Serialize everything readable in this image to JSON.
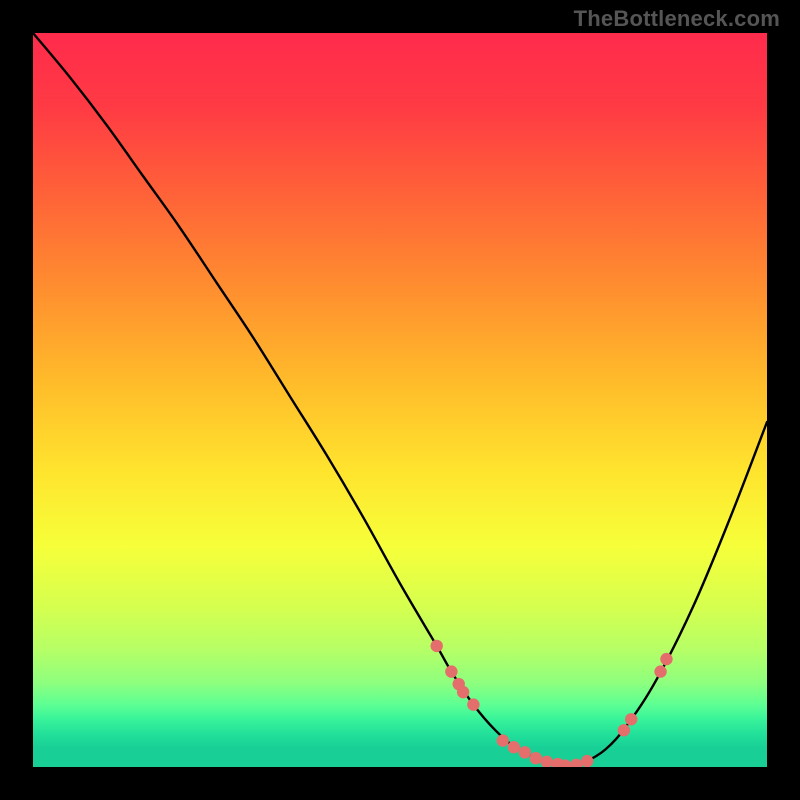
{
  "watermark": "TheBottleneck.com",
  "colors": {
    "background": "#000000",
    "curve": "#000000",
    "dot_fill": "#e46e6b",
    "gradient_stops": [
      {
        "offset": 0.0,
        "color": "#ff2b4c"
      },
      {
        "offset": 0.1,
        "color": "#ff3a44"
      },
      {
        "offset": 0.22,
        "color": "#ff6238"
      },
      {
        "offset": 0.35,
        "color": "#ff8f2f"
      },
      {
        "offset": 0.48,
        "color": "#ffbd2a"
      },
      {
        "offset": 0.6,
        "color": "#ffe52e"
      },
      {
        "offset": 0.7,
        "color": "#f6ff3a"
      },
      {
        "offset": 0.78,
        "color": "#d6ff4e"
      },
      {
        "offset": 0.84,
        "color": "#b6ff66"
      },
      {
        "offset": 0.885,
        "color": "#8eff7e"
      },
      {
        "offset": 0.915,
        "color": "#5dff93"
      },
      {
        "offset": 0.935,
        "color": "#38f39a"
      },
      {
        "offset": 0.955,
        "color": "#22e09a"
      },
      {
        "offset": 0.975,
        "color": "#18cf96"
      },
      {
        "offset": 1.0,
        "color": "#18cf96"
      }
    ]
  },
  "chart_data": {
    "type": "line",
    "title": "",
    "xlabel": "",
    "ylabel": "",
    "xlim": [
      0,
      100
    ],
    "ylim": [
      0,
      100
    ],
    "grid": false,
    "legend": false,
    "series": [
      {
        "name": "bottleneck-curve",
        "x": [
          0,
          5,
          10,
          15,
          20,
          25,
          30,
          35,
          40,
          45,
          50,
          55,
          57,
          60,
          63,
          66,
          70,
          73,
          75,
          78,
          81,
          85,
          90,
          95,
          100
        ],
        "y": [
          100,
          94,
          87.5,
          80.5,
          73.5,
          66,
          58.5,
          50.5,
          42.5,
          34,
          25,
          16.5,
          13,
          8.5,
          5,
          2.5,
          0.7,
          0.2,
          0.6,
          2.4,
          5.8,
          12,
          22,
          34,
          47
        ]
      }
    ],
    "markers": [
      {
        "x": 55.0,
        "y": 16.5
      },
      {
        "x": 57.0,
        "y": 13.0
      },
      {
        "x": 58.0,
        "y": 11.3
      },
      {
        "x": 58.6,
        "y": 10.2
      },
      {
        "x": 60.0,
        "y": 8.5
      },
      {
        "x": 64.0,
        "y": 3.6
      },
      {
        "x": 65.5,
        "y": 2.7
      },
      {
        "x": 67.0,
        "y": 2.0
      },
      {
        "x": 68.5,
        "y": 1.2
      },
      {
        "x": 70.0,
        "y": 0.7
      },
      {
        "x": 71.5,
        "y": 0.4
      },
      {
        "x": 72.5,
        "y": 0.2
      },
      {
        "x": 74.0,
        "y": 0.3
      },
      {
        "x": 75.5,
        "y": 0.8
      },
      {
        "x": 80.5,
        "y": 5.0
      },
      {
        "x": 81.5,
        "y": 6.5
      },
      {
        "x": 85.5,
        "y": 13.0
      },
      {
        "x": 86.3,
        "y": 14.7
      }
    ]
  }
}
